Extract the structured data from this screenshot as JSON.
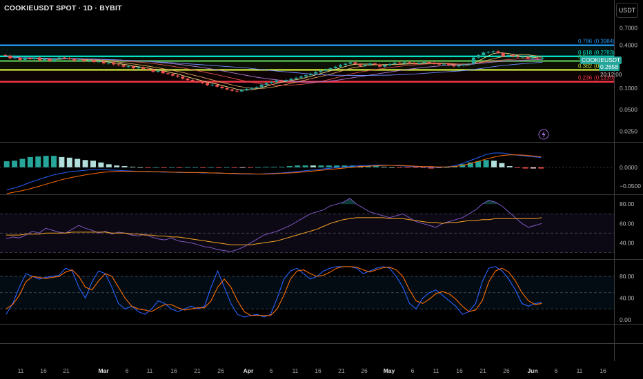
{
  "header": {
    "symbol_title": "COOKIEUSDT SPOT · 1D · BYBIT",
    "currency_button": "USDT"
  },
  "price_badges": {
    "symbol": "COOKIEUSDT",
    "price": "0.2658",
    "countdown": "20:12:00"
  },
  "colors": {
    "background": "#000000",
    "bull_candle": "#26a69a",
    "bear_candle": "#ef5350",
    "fib_0786": "#2196f3",
    "fib_0618": "#00e5c8",
    "fib_05": "#4caf50",
    "fib_0382": "#c6e63c",
    "fib_0236": "#f23645",
    "macd_line": "#2962ff",
    "signal_line": "#ff6d00",
    "rsi_line": "#7e57c2",
    "rsi_ma": "#f5a623",
    "stoch_k": "#2962ff",
    "stoch_d": "#ff6d00",
    "price_badge": "#26a69a"
  },
  "icons": [
    "lightning-bolt-icon"
  ],
  "chart_data": [
    {
      "type": "candlestick",
      "panel": "price",
      "title": "COOKIEUSDT SPOT · 1D · BYBIT",
      "y_scale": "log",
      "y_axis_ticks": [
        "0.7000",
        "0.4000",
        "0.1000",
        "0.0500",
        "0.0250"
      ],
      "y_tick_values": [
        0.7,
        0.4,
        0.1,
        0.05,
        0.025
      ],
      "ylim": [
        0.0185,
        1.05
      ],
      "x_axis_ticks": [
        "11",
        "16",
        "21",
        "Mar",
        "6",
        "11",
        "16",
        "21",
        "26",
        "Apr",
        "6",
        "11",
        "16",
        "21",
        "26",
        "May",
        "6",
        "11",
        "16",
        "21",
        "26",
        "Jun",
        "6",
        "11",
        "16"
      ],
      "close_values": [
        0.285,
        0.262,
        0.268,
        0.248,
        0.265,
        0.255,
        0.268,
        0.245,
        0.258,
        0.24,
        0.258,
        0.268,
        0.262,
        0.255,
        0.242,
        0.25,
        0.238,
        0.245,
        0.232,
        0.236,
        0.222,
        0.228,
        0.215,
        0.21,
        0.2,
        0.202,
        0.19,
        0.196,
        0.186,
        0.182,
        0.17,
        0.175,
        0.162,
        0.158,
        0.15,
        0.145,
        0.136,
        0.13,
        0.125,
        0.124,
        0.118,
        0.11,
        0.112,
        0.105,
        0.1,
        0.096,
        0.092,
        0.09,
        0.094,
        0.098,
        0.101,
        0.104,
        0.112,
        0.118,
        0.122,
        0.128,
        0.125,
        0.13,
        0.135,
        0.14,
        0.146,
        0.152,
        0.16,
        0.168,
        0.175,
        0.182,
        0.19,
        0.2,
        0.212,
        0.22,
        0.23,
        0.218,
        0.205,
        0.212,
        0.222,
        0.215,
        0.2,
        0.21,
        0.218,
        0.228,
        0.222,
        0.23,
        0.225,
        0.218,
        0.226,
        0.232,
        0.228,
        0.22,
        0.214,
        0.22,
        0.21,
        0.202,
        0.208,
        0.215,
        0.22,
        0.268,
        0.29,
        0.315,
        0.32,
        0.328,
        0.31,
        0.28,
        0.29,
        0.278,
        0.27,
        0.275,
        0.262,
        0.266,
        0.26,
        0.2658
      ],
      "fib_levels": [
        {
          "ratio": "0.786",
          "price": "(0.3984)",
          "value": 0.3984
        },
        {
          "ratio": "0.618",
          "price": "(0.2783)",
          "value": 0.2783
        },
        {
          "ratio": "0.5",
          "price": "",
          "value": 0.24
        },
        {
          "ratio": "0.382",
          "price": "(0.1801)",
          "value": 0.1801
        },
        {
          "ratio": "0.236",
          "price": "(0.1230)",
          "value": 0.123
        }
      ]
    },
    {
      "type": "macd",
      "panel": "macd",
      "y_axis_ticks": [
        "0.0000",
        "−0.0500"
      ],
      "y_tick_values": [
        0.0,
        -0.05
      ],
      "ylim": [
        -0.07,
        0.06
      ],
      "macd_values": [
        -0.06,
        -0.055,
        -0.048,
        -0.04,
        -0.033,
        -0.026,
        -0.02,
        -0.016,
        -0.012,
        -0.01,
        -0.008,
        -0.006,
        -0.006,
        -0.007,
        -0.008,
        -0.009,
        -0.01,
        -0.011,
        -0.012,
        -0.012,
        -0.013,
        -0.013,
        -0.014,
        -0.014,
        -0.014,
        -0.015,
        -0.015,
        -0.016,
        -0.016,
        -0.017,
        -0.018,
        -0.018,
        -0.018,
        -0.017,
        -0.016,
        -0.015,
        -0.013,
        -0.011,
        -0.009,
        -0.007,
        -0.005,
        -0.003,
        -0.001,
        0.001,
        0.003,
        0.004,
        0.005,
        0.006,
        0.006,
        0.005,
        0.004,
        0.003,
        0.002,
        0.001,
        0.0,
        0.0,
        0.001,
        0.004,
        0.01,
        0.018,
        0.026,
        0.034,
        0.038,
        0.038,
        0.035,
        0.032,
        0.03,
        0.028,
        0.026
      ],
      "signal_values": [
        -0.07,
        -0.066,
        -0.062,
        -0.057,
        -0.051,
        -0.045,
        -0.039,
        -0.033,
        -0.028,
        -0.024,
        -0.02,
        -0.017,
        -0.014,
        -0.012,
        -0.011,
        -0.011,
        -0.011,
        -0.011,
        -0.011,
        -0.012,
        -0.012,
        -0.013,
        -0.013,
        -0.014,
        -0.014,
        -0.014,
        -0.015,
        -0.015,
        -0.016,
        -0.016,
        -0.017,
        -0.017,
        -0.018,
        -0.018,
        -0.017,
        -0.016,
        -0.015,
        -0.014,
        -0.012,
        -0.01,
        -0.008,
        -0.006,
        -0.004,
        -0.002,
        0.0,
        0.002,
        0.003,
        0.004,
        0.005,
        0.005,
        0.005,
        0.004,
        0.003,
        0.002,
        0.002,
        0.001,
        0.001,
        0.002,
        0.005,
        0.01,
        0.016,
        0.022,
        0.027,
        0.031,
        0.033,
        0.033,
        0.032,
        0.03,
        0.028
      ]
    },
    {
      "type": "line",
      "panel": "rsi",
      "y_axis_ticks": [
        "80.00",
        "60.00",
        "40.00"
      ],
      "y_tick_values": [
        80,
        60,
        40
      ],
      "ylim": [
        26,
        88
      ],
      "band": [
        30,
        70
      ],
      "rsi_values": [
        44,
        46,
        45,
        48,
        52,
        50,
        55,
        53,
        51,
        50,
        54,
        58,
        55,
        53,
        50,
        52,
        49,
        51,
        50,
        48,
        47,
        49,
        46,
        44,
        43,
        45,
        42,
        41,
        40,
        38,
        36,
        35,
        33,
        32,
        31,
        33,
        36,
        40,
        44,
        48,
        50,
        52,
        55,
        58,
        62,
        66,
        70,
        72,
        74,
        78,
        80,
        82,
        86,
        80,
        76,
        72,
        70,
        68,
        66,
        68,
        70,
        66,
        62,
        60,
        58,
        56,
        60,
        62,
        64,
        66,
        70,
        74,
        80,
        84,
        82,
        78,
        72,
        66,
        60,
        56,
        58,
        60
      ],
      "rsi_ma_values": [
        48,
        48,
        48,
        49,
        49,
        49,
        50,
        50,
        50,
        50,
        51,
        51,
        51,
        51,
        51,
        51,
        50,
        50,
        50,
        49,
        49,
        48,
        48,
        47,
        47,
        46,
        46,
        45,
        44,
        43,
        42,
        41,
        40,
        39,
        38,
        38,
        38,
        38,
        39,
        40,
        41,
        42,
        44,
        46,
        48,
        50,
        52,
        54,
        57,
        60,
        62,
        64,
        65,
        66,
        66,
        66,
        66,
        66,
        65,
        65,
        65,
        64,
        63,
        62,
        61,
        61,
        60,
        61,
        61,
        62,
        63,
        63,
        64,
        64,
        65,
        65,
        65,
        65,
        65,
        65,
        65,
        66
      ]
    },
    {
      "type": "line",
      "panel": "stochastic",
      "y_axis_ticks": [
        "80.00",
        "40.00",
        "0.00"
      ],
      "y_tick_values": [
        80,
        40,
        0
      ],
      "ylim": [
        -5,
        108
      ],
      "band": [
        20,
        80
      ],
      "k_values": [
        10,
        30,
        60,
        85,
        80,
        75,
        78,
        80,
        82,
        95,
        90,
        60,
        40,
        70,
        90,
        85,
        60,
        30,
        20,
        25,
        15,
        10,
        20,
        35,
        30,
        20,
        15,
        20,
        25,
        20,
        25,
        60,
        90,
        60,
        30,
        10,
        5,
        8,
        10,
        5,
        10,
        40,
        75,
        90,
        95,
        85,
        75,
        80,
        90,
        95,
        98,
        98,
        98,
        95,
        85,
        90,
        95,
        98,
        95,
        80,
        60,
        30,
        20,
        40,
        50,
        55,
        45,
        35,
        25,
        10,
        15,
        30,
        70,
        95,
        98,
        90,
        75,
        55,
        30,
        25,
        30,
        32
      ],
      "d_values": [
        20,
        28,
        45,
        70,
        80,
        78,
        76,
        78,
        80,
        88,
        92,
        80,
        60,
        55,
        72,
        85,
        80,
        60,
        40,
        25,
        20,
        18,
        15,
        22,
        28,
        28,
        22,
        18,
        20,
        22,
        22,
        35,
        60,
        75,
        60,
        35,
        15,
        8,
        8,
        8,
        8,
        20,
        45,
        75,
        90,
        92,
        85,
        80,
        82,
        88,
        95,
        98,
        98,
        97,
        92,
        88,
        92,
        96,
        97,
        92,
        80,
        55,
        35,
        30,
        38,
        48,
        52,
        48,
        38,
        25,
        15,
        18,
        35,
        70,
        90,
        95,
        88,
        72,
        50,
        35,
        28,
        30
      ]
    }
  ]
}
